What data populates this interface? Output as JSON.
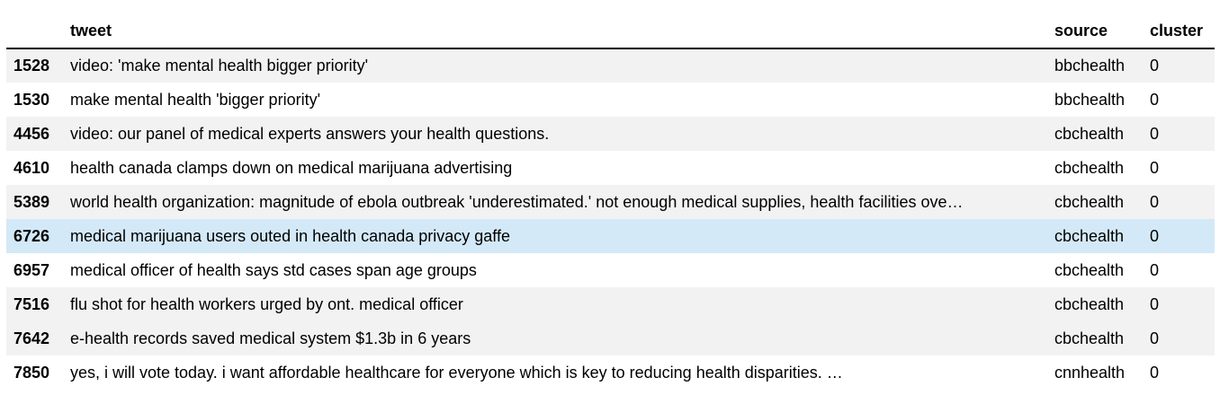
{
  "table": {
    "index_header": "",
    "columns": {
      "tweet": "tweet",
      "source": "source",
      "cluster": "cluster"
    },
    "rows": [
      {
        "index": "1528",
        "tweet": "video: 'make mental health bigger priority'",
        "source": "bbchealth",
        "cluster": "0"
      },
      {
        "index": "1530",
        "tweet": "make mental health 'bigger priority'",
        "source": "bbchealth",
        "cluster": "0"
      },
      {
        "index": "4456",
        "tweet": "video: our panel of medical experts answers your health questions.",
        "source": "cbchealth",
        "cluster": "0"
      },
      {
        "index": "4610",
        "tweet": "health canada clamps down on medical marijuana advertising",
        "source": "cbchealth",
        "cluster": "0"
      },
      {
        "index": "5389",
        "tweet": "world health organization: magnitude of ebola outbreak 'underestimated.' not enough medical supplies, health facilities ove…",
        "source": "cbchealth",
        "cluster": "0"
      },
      {
        "index": "6726",
        "tweet": "medical marijuana users outed in health canada privacy gaffe",
        "source": "cbchealth",
        "cluster": "0"
      },
      {
        "index": "6957",
        "tweet": "medical officer of health says std cases span age groups",
        "source": "cbchealth",
        "cluster": "0"
      },
      {
        "index": "7516",
        "tweet": "flu shot for health workers urged by ont. medical officer",
        "source": "cbchealth",
        "cluster": "0"
      },
      {
        "index": "7642",
        "tweet": "e-health records saved medical system $1.3b in 6 years",
        "source": "cbchealth",
        "cluster": "0"
      },
      {
        "index": "7850",
        "tweet": "yes, i will vote today. i want affordable healthcare for everyone which is key to reducing health disparities. …",
        "source": "cnnhealth",
        "cluster": "0"
      }
    ]
  },
  "colors": {
    "stripe": "#f2f2f2",
    "hover_row": "#d4e9f7",
    "header_rule": "#000000"
  }
}
